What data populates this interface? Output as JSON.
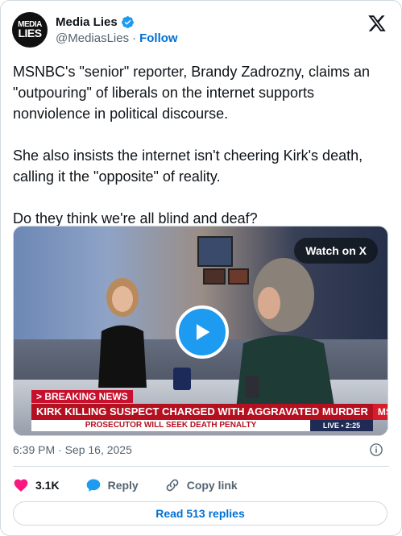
{
  "author": {
    "display_name": "Media Lies",
    "handle": "@MediasLies",
    "follow_label": "Follow",
    "avatar_line1": "MEDIA",
    "avatar_line2": "LIES",
    "verified": true
  },
  "tweet": {
    "paragraphs": [
      "MSNBC's \"senior\" reporter, Brandy Zadrozny, claims an \"outpouring\" of liberals on the internet supports nonviolence in political discourse.",
      "She also insists the internet isn't cheering Kirk's death, calling it the \"opposite\" of reality.",
      "Do they think we're all blind and deaf?"
    ]
  },
  "media": {
    "watch_label": "Watch on X",
    "breaking_label": "> BREAKING NEWS",
    "headline": "KIRK KILLING SUSPECT CHARGED WITH AGGRAVATED MURDER",
    "subline": "PROSECUTOR WILL SEEK DEATH PENALTY",
    "network": "MSNBC",
    "live_label": "LIVE • 2:25"
  },
  "timestamp": "6:39 PM · Sep 16, 2025",
  "actions": {
    "likes": "3.1K",
    "reply_label": "Reply",
    "copy_link_label": "Copy link"
  },
  "read_replies_label": "Read 513 replies",
  "colors": {
    "link_blue": "#006fd6",
    "verified_blue": "#1d9bf0",
    "heart_red": "#f91880",
    "breaking_red": "#c8102e"
  },
  "icons": [
    "verified-badge-icon",
    "x-logo-icon",
    "play-icon",
    "info-icon",
    "heart-icon",
    "reply-icon",
    "link-icon"
  ]
}
